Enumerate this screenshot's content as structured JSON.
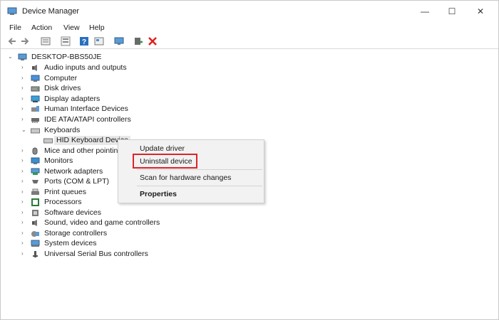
{
  "window": {
    "title": "Device Manager",
    "controls": {
      "minimize": "—",
      "maximize": "☐",
      "close": "✕"
    }
  },
  "menu": [
    "File",
    "Action",
    "View",
    "Help"
  ],
  "toolbar": {
    "icons": [
      "back-arrow-icon",
      "forward-arrow-icon",
      "properties-icon",
      "device-list-icon",
      "help-icon",
      "view-icon",
      "monitor-icon",
      "update-driver-icon",
      "uninstall-x-icon"
    ]
  },
  "tree": {
    "root": "DESKTOP-BBS50JE",
    "categories": [
      "Audio inputs and outputs",
      "Computer",
      "Disk drives",
      "Display adapters",
      "Human Interface Devices",
      "IDE ATA/ATAPI controllers",
      "Keyboards",
      "HID Keyboard Device",
      "Mice and other pointing devices",
      "Monitors",
      "Network adapters",
      "Ports (COM & LPT)",
      "Print queues",
      "Processors",
      "Software devices",
      "Sound, video and game controllers",
      "Storage controllers",
      "System devices",
      "Universal Serial Bus controllers"
    ]
  },
  "context_menu": {
    "update": "Update driver",
    "uninstall": "Uninstall device",
    "scan": "Scan for hardware changes",
    "properties": "Properties"
  },
  "colors": {
    "highlight_border": "#d9262c",
    "menu_bg": "#f2f2f2"
  }
}
